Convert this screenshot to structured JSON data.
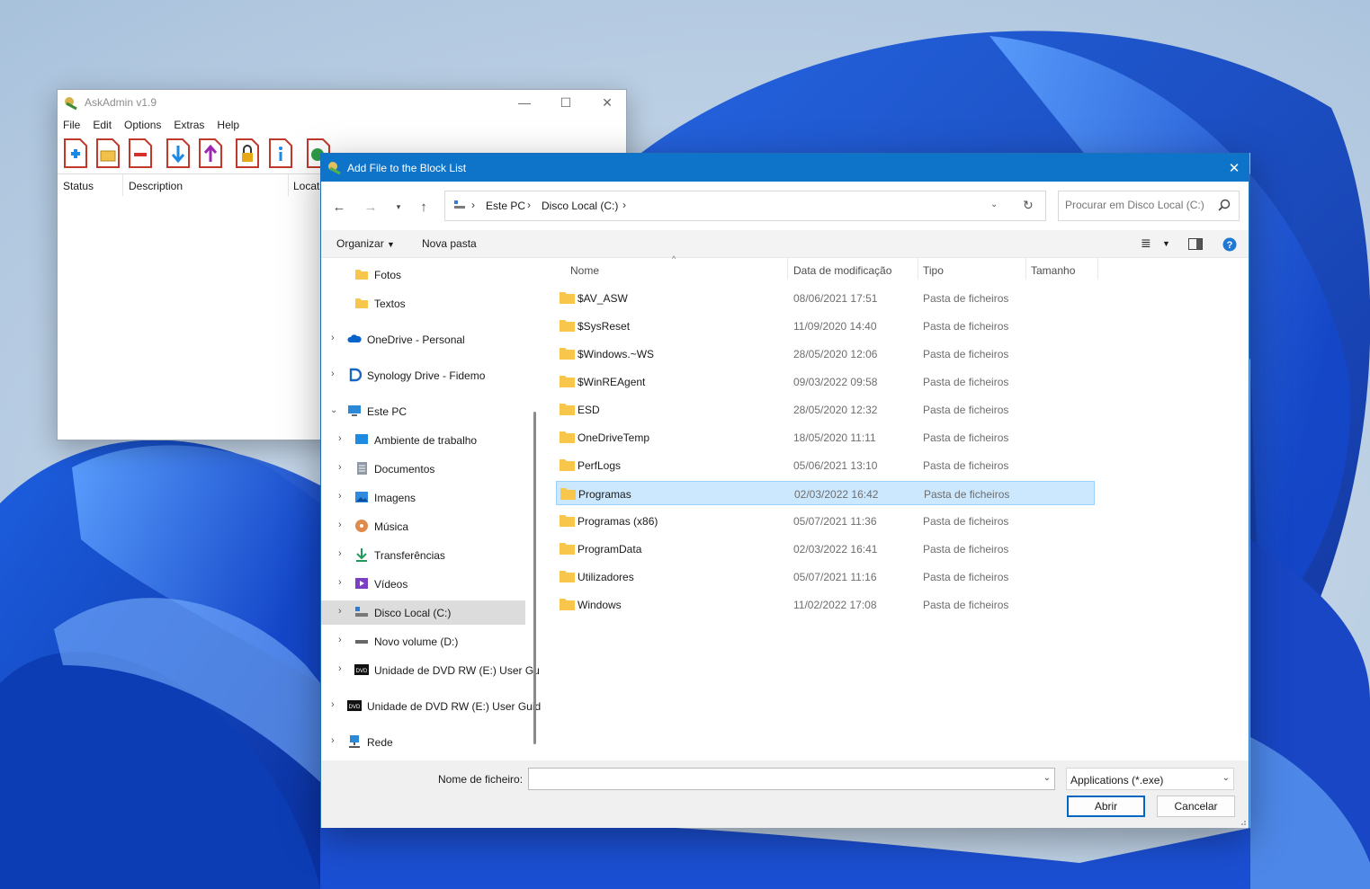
{
  "askadmin": {
    "title": "AskAdmin v1.9",
    "menu": [
      "File",
      "Edit",
      "Options",
      "Extras",
      "Help"
    ],
    "columns": [
      "Status",
      "Description",
      "Locat"
    ]
  },
  "dialog": {
    "title": "Add File to the Block List",
    "breadcrumb": [
      "Este PC",
      "Disco Local (C:)"
    ],
    "search_placeholder": "Procurar em Disco Local (C:)",
    "commands": {
      "organize": "Organizar",
      "new_folder": "Nova pasta"
    },
    "nav": [
      {
        "label": "Fotos",
        "icon": "folder-icon"
      },
      {
        "label": "Textos",
        "icon": "folder-icon"
      },
      {
        "label": "OneDrive - Personal",
        "icon": "onedrive-icon"
      },
      {
        "label": "Synology Drive - Fidemo",
        "icon": "synology-drive-icon"
      },
      {
        "label": "Este PC",
        "icon": "computer-icon"
      },
      {
        "label": "Ambiente de trabalho",
        "icon": "desktop-icon"
      },
      {
        "label": "Documentos",
        "icon": "documents-icon"
      },
      {
        "label": "Imagens",
        "icon": "pictures-icon"
      },
      {
        "label": "Música",
        "icon": "music-icon"
      },
      {
        "label": "Transferências",
        "icon": "downloads-icon"
      },
      {
        "label": "Vídeos",
        "icon": "videos-icon"
      },
      {
        "label": "Disco Local (C:)",
        "icon": "local-disk-icon"
      },
      {
        "label": "Novo volume (D:)",
        "icon": "drive-icon"
      },
      {
        "label": "Unidade de DVD RW (E:) User Gu",
        "icon": "dvd-icon"
      },
      {
        "label": "Unidade de DVD RW (E:) User Guid",
        "icon": "dvd-icon"
      },
      {
        "label": "Rede",
        "icon": "network-icon"
      }
    ],
    "columns": {
      "name": "Nome",
      "date": "Data de modificação",
      "type": "Tipo",
      "size": "Tamanho"
    },
    "files": [
      {
        "name": "$AV_ASW",
        "date": "08/06/2021 17:51",
        "type": "Pasta de ficheiros"
      },
      {
        "name": "$SysReset",
        "date": "11/09/2020 14:40",
        "type": "Pasta de ficheiros"
      },
      {
        "name": "$Windows.~WS",
        "date": "28/05/2020 12:06",
        "type": "Pasta de ficheiros"
      },
      {
        "name": "$WinREAgent",
        "date": "09/03/2022 09:58",
        "type": "Pasta de ficheiros"
      },
      {
        "name": "ESD",
        "date": "28/05/2020 12:32",
        "type": "Pasta de ficheiros"
      },
      {
        "name": "OneDriveTemp",
        "date": "18/05/2020 11:11",
        "type": "Pasta de ficheiros"
      },
      {
        "name": "PerfLogs",
        "date": "05/06/2021 13:10",
        "type": "Pasta de ficheiros"
      },
      {
        "name": "Programas",
        "date": "02/03/2022 16:42",
        "type": "Pasta de ficheiros",
        "selected": true
      },
      {
        "name": "Programas (x86)",
        "date": "05/07/2021 11:36",
        "type": "Pasta de ficheiros"
      },
      {
        "name": "ProgramData",
        "date": "02/03/2022 16:41",
        "type": "Pasta de ficheiros"
      },
      {
        "name": "Utilizadores",
        "date": "05/07/2021 11:16",
        "type": "Pasta de ficheiros"
      },
      {
        "name": "Windows",
        "date": "11/02/2022 17:08",
        "type": "Pasta de ficheiros"
      }
    ],
    "footer": {
      "filename_label": "Nome de ficheiro:",
      "filename_value": "",
      "filter": "Applications (*.exe)",
      "open": "Abrir",
      "cancel": "Cancelar"
    }
  },
  "colors": {
    "accent": "#0e74c9",
    "selection": "#cce8ff",
    "folder": "#f8c64b"
  }
}
